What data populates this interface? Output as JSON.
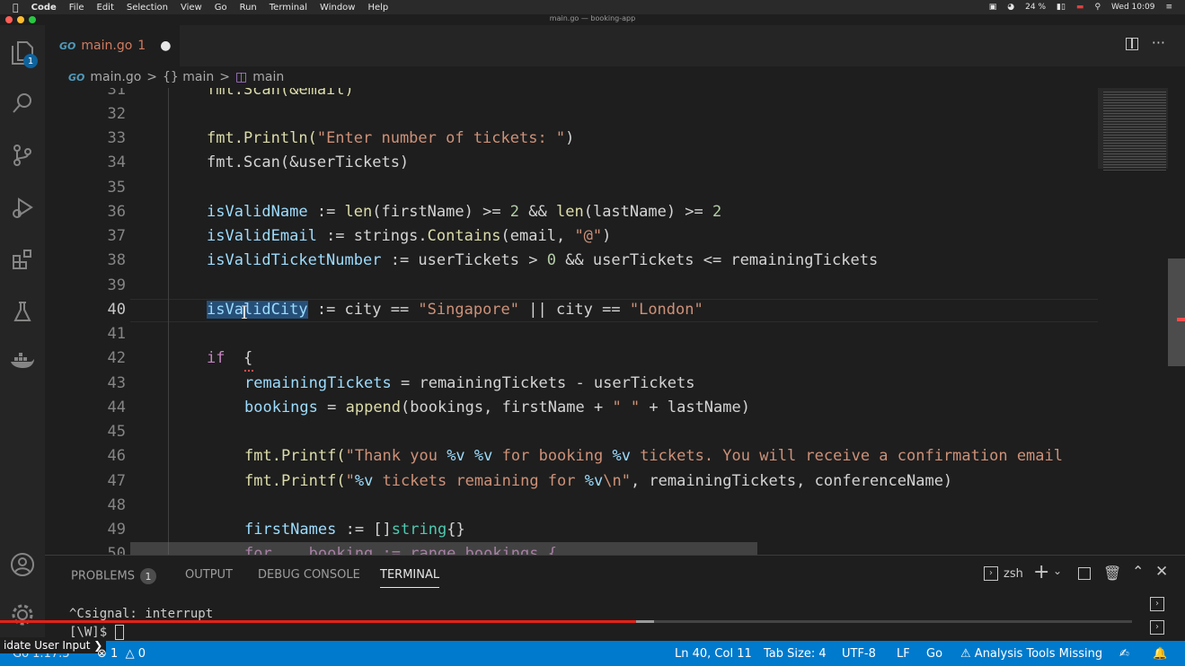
{
  "menubar": {
    "app": "Code",
    "items": [
      "File",
      "Edit",
      "Selection",
      "View",
      "Go",
      "Run",
      "Terminal",
      "Window",
      "Help"
    ],
    "battery": "24 %",
    "clock": "Wed 10:09"
  },
  "window_title": "main.go — booking-app",
  "activity": {
    "explorer_badge": "1"
  },
  "tab": {
    "name": "main.go",
    "problems": "1",
    "go_label": "GO"
  },
  "breadcrumb": {
    "file": "main.go",
    "sep": ">",
    "ns": "{} main",
    "symbol": "main"
  },
  "editor": {
    "lines": [
      {
        "n": "31",
        "text": "fmt.Scan(&email)"
      },
      {
        "n": "32"
      },
      {
        "n": "33"
      },
      {
        "n": "34"
      },
      {
        "n": "35"
      },
      {
        "n": "36"
      },
      {
        "n": "37"
      },
      {
        "n": "38"
      },
      {
        "n": "39"
      },
      {
        "n": "40"
      },
      {
        "n": "41"
      },
      {
        "n": "42"
      },
      {
        "n": "43"
      },
      {
        "n": "44"
      },
      {
        "n": "45"
      },
      {
        "n": "46"
      },
      {
        "n": "47"
      },
      {
        "n": "48"
      },
      {
        "n": "49"
      },
      {
        "n": "50"
      }
    ],
    "tokens": {
      "l33_fn": "fmt.Println(",
      "l33_str": "\"Enter number of tickets: \"",
      "l33_end": ")",
      "l34": "fmt.Scan(&userTickets)",
      "l36_var": "isValidName",
      "l36_op": " := ",
      "l36_len": "len",
      "l36_a": "(firstName) >= ",
      "l36_n": "2",
      "l36_b": " && ",
      "l36_len2": "len",
      "l36_c": "(lastName) >= ",
      "l36_n2": "2",
      "l37_var": "isValidEmail",
      "l37_op": " := strings.",
      "l37_fn": "Contains",
      "l37_a": "(email, ",
      "l37_str": "\"@\"",
      "l37_end": ")",
      "l38_var": "isValidTicketNumber",
      "l38_a": " := userTickets > ",
      "l38_n": "0",
      "l38_b": " && userTickets <= remainingTickets",
      "l40_var": "isValidCity",
      "l40_a": " := city == ",
      "l40_str": "\"Singapore\"",
      "l40_b": " || city == ",
      "l40_str2": "\"London\"",
      "l42_kw": "if",
      "l42_a": "  {",
      "l43_var": "remainingTickets",
      "l43_a": " = remainingTickets - userTickets",
      "l44_var": "bookings",
      "l44_a": " = ",
      "l44_fn": "append",
      "l44_b": "(bookings, firstName + ",
      "l44_str": "\" \"",
      "l44_c": " + lastName)",
      "l46_fn": "fmt.Printf(",
      "l46_str": "\"Thank you ",
      "l46_v1": "%v",
      "l46_s2": " ",
      "l46_v2": "%v",
      "l46_s3": " for booking ",
      "l46_v3": "%v",
      "l46_s4": " tickets. You will receive a confirmation email",
      "l47_fn": "fmt.Printf(",
      "l47_str": "\"",
      "l47_v1": "%v",
      "l47_s2": " tickets remaining for ",
      "l47_v2": "%v",
      "l47_s3": "\\n\"",
      "l47_b": ", remainingTickets, conferenceName)",
      "l49_var": "firstNames",
      "l49_a": " := []",
      "l49_ty": "string",
      "l49_b": "{}",
      "l50": "for _, booking := range bookings {"
    }
  },
  "panel": {
    "tabs": [
      "PROBLEMS",
      "OUTPUT",
      "DEBUG CONSOLE",
      "TERMINAL"
    ],
    "problems_count": "1",
    "shell": "zsh",
    "term_line1": "^Csignal: interrupt",
    "term_line2": "[\\W]$ "
  },
  "status": {
    "go_version": "Go 1.17.3",
    "errors": "1",
    "warnings": "0",
    "overlay_text": "idate User Input",
    "position": "Ln 40, Col 11",
    "tab_size": "Tab Size: 4",
    "encoding": "UTF-8",
    "eol": "LF",
    "lang": "Go",
    "analysis": "Analysis Tools Missing"
  },
  "colors": {
    "status_bar": "#007acc",
    "tab_modified": "#d17b5f",
    "keyword": "#c586c0",
    "function": "#dcdcaa",
    "variable": "#9cdcfe",
    "string": "#ce9178"
  }
}
